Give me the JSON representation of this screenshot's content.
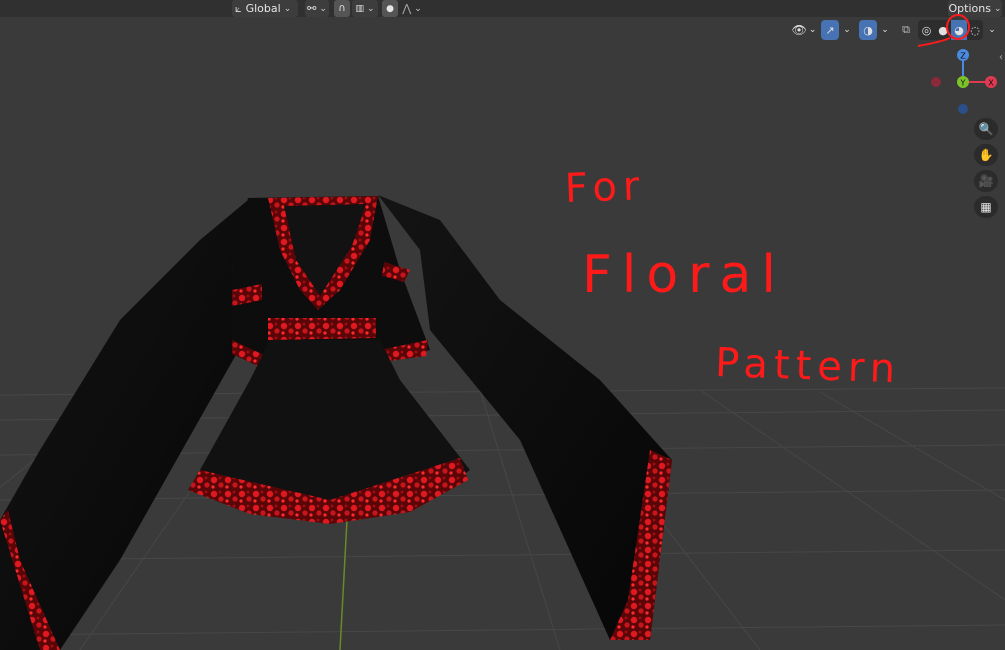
{
  "header": {
    "transform_orientation": "Global",
    "options_label": "Options"
  },
  "gizmo": {
    "z_label": "Z",
    "x_label": "X",
    "y_label": "Y"
  },
  "icons": {
    "orientation": "transform-orientation-icon",
    "pivot": "pivot-point-icon",
    "snap": "snap-icon",
    "proportional": "proportional-editing-icon",
    "falloff": "falloff-curve-icon",
    "visibility": "visibility-eye-icon",
    "gizmo_toggle": "gizmo-toggle-icon",
    "overlays": "overlays-icon",
    "xray": "xray-icon",
    "wireframe": "wireframe-shading-icon",
    "solid": "solid-shading-icon",
    "material": "material-preview-icon",
    "rendered": "rendered-shading-icon",
    "zoom": "zoom-icon",
    "pan": "hand-pan-icon",
    "camera": "camera-icon",
    "ortho": "perspective-grid-icon"
  },
  "annotation": {
    "line1": "For",
    "line2": "Floral",
    "line3": "Pattern",
    "color": "#ff1a1a"
  },
  "scene": {
    "background": "#3a3a3a",
    "garment_color": "#0a0a0a",
    "trim_color": "#c8151b"
  }
}
